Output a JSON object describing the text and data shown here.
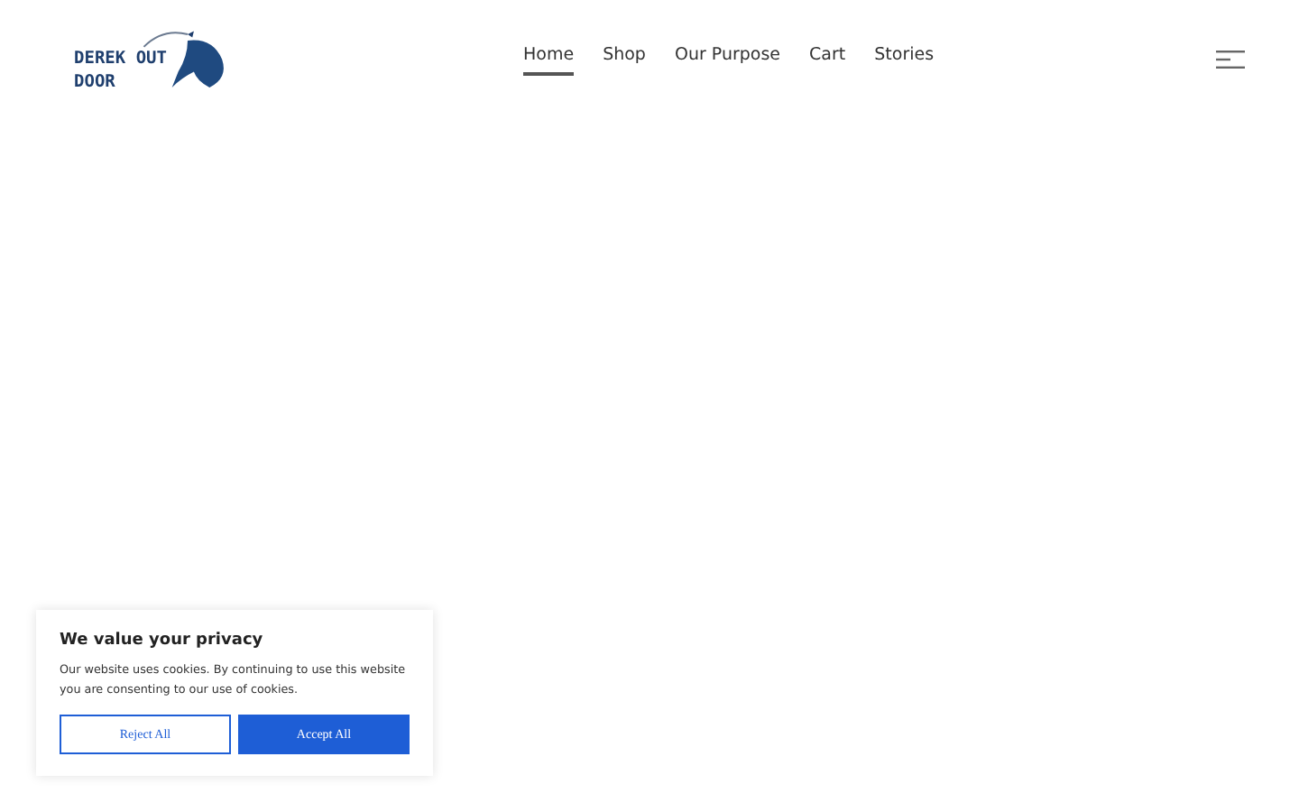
{
  "logo": {
    "lines": [
      "DEREK OUT",
      "DOOR"
    ]
  },
  "nav": [
    {
      "label": "Home",
      "selected": true
    },
    {
      "label": "Shop",
      "selected": false
    },
    {
      "label": "Our Purpose",
      "selected": false
    },
    {
      "label": "Cart",
      "selected": false
    },
    {
      "label": "Stories",
      "selected": false
    }
  ],
  "cookie_banner": {
    "title": "We value your privacy",
    "text": "Our website uses cookies. By continuing to use this website you are consenting to our use of cookies.",
    "buttons": [
      {
        "label": "Reject All",
        "kind": "secondary"
      },
      {
        "label": "Accept All",
        "kind": "primary"
      }
    ]
  }
}
